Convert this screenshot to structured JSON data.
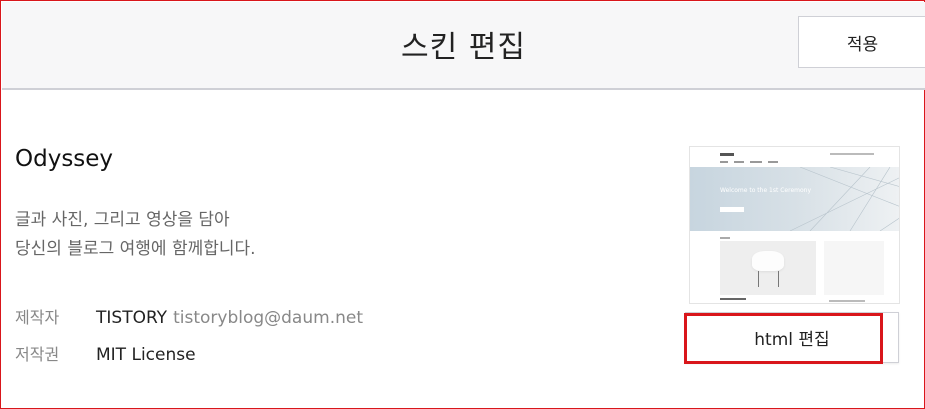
{
  "header": {
    "title": "스킨 편집",
    "apply_label": "적용"
  },
  "skin": {
    "name": "Odyssey",
    "description_line1": "글과 사진, 그리고 영상을 담아",
    "description_line2": "당신의 블로그 여행에 함께합니다.",
    "maker_label": "제작자",
    "maker_name": "TISTORY",
    "maker_email": "tistoryblog@daum.net",
    "license_label": "저작권",
    "license_value": "MIT License",
    "thumbnail_hero_text": "Welcome to the 1st Ceremony"
  },
  "actions": {
    "html_edit_label": "html 편집"
  },
  "colors": {
    "highlight": "#d9161b",
    "header_bg": "#f7f7f8"
  }
}
